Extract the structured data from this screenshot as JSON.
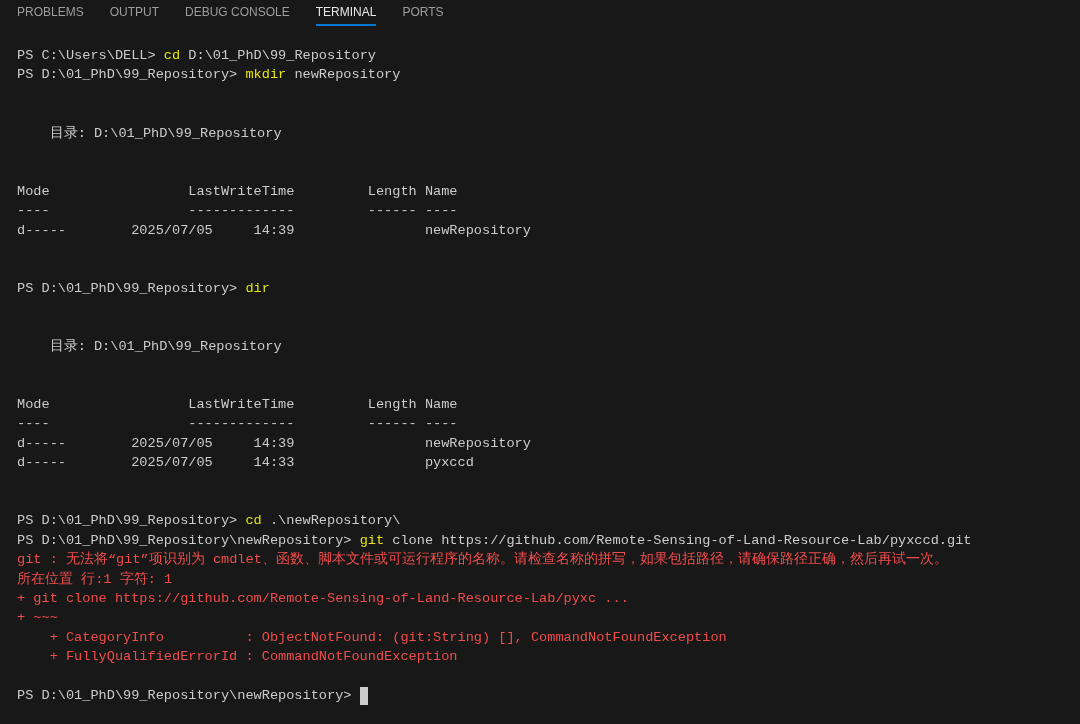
{
  "tabs": [
    {
      "label": "PROBLEMS",
      "selected": false
    },
    {
      "label": "OUTPUT",
      "selected": false
    },
    {
      "label": "DEBUG CONSOLE",
      "selected": false
    },
    {
      "label": "TERMINAL",
      "selected": true
    },
    {
      "label": "PORTS",
      "selected": false
    }
  ],
  "terminal": {
    "lines": [
      {
        "kind": "text",
        "segments": [
          {
            "kind": "prompt",
            "text": "PS C:\\Users\\DELL> "
          },
          {
            "kind": "command",
            "text": "cd"
          },
          {
            "kind": "plain",
            "text": " D:\\01_PhD\\99_Repository"
          }
        ]
      },
      {
        "kind": "text",
        "segments": [
          {
            "kind": "prompt",
            "text": "PS D:\\01_PhD\\99_Repository> "
          },
          {
            "kind": "command",
            "text": "mkdir"
          },
          {
            "kind": "plain",
            "text": " newRepository"
          }
        ]
      },
      {
        "kind": "blank"
      },
      {
        "kind": "blank"
      },
      {
        "kind": "text",
        "segments": [
          {
            "kind": "plain",
            "text": "    目录: D:\\01_PhD\\99_Repository"
          }
        ]
      },
      {
        "kind": "blank"
      },
      {
        "kind": "blank"
      },
      {
        "kind": "text",
        "segments": [
          {
            "kind": "plain",
            "text": "Mode                 LastWriteTime         Length Name"
          }
        ]
      },
      {
        "kind": "text",
        "segments": [
          {
            "kind": "plain",
            "text": "----                 -------------         ------ ----"
          }
        ]
      },
      {
        "kind": "text",
        "segments": [
          {
            "kind": "plain",
            "text": "d-----        2025/07/05     14:39                newRepository"
          }
        ]
      },
      {
        "kind": "blank"
      },
      {
        "kind": "blank"
      },
      {
        "kind": "text",
        "segments": [
          {
            "kind": "prompt",
            "text": "PS D:\\01_PhD\\99_Repository> "
          },
          {
            "kind": "command",
            "text": "dir"
          }
        ]
      },
      {
        "kind": "blank"
      },
      {
        "kind": "blank"
      },
      {
        "kind": "text",
        "segments": [
          {
            "kind": "plain",
            "text": "    目录: D:\\01_PhD\\99_Repository"
          }
        ]
      },
      {
        "kind": "blank"
      },
      {
        "kind": "blank"
      },
      {
        "kind": "text",
        "segments": [
          {
            "kind": "plain",
            "text": "Mode                 LastWriteTime         Length Name"
          }
        ]
      },
      {
        "kind": "text",
        "segments": [
          {
            "kind": "plain",
            "text": "----                 -------------         ------ ----"
          }
        ]
      },
      {
        "kind": "text",
        "segments": [
          {
            "kind": "plain",
            "text": "d-----        2025/07/05     14:39                newRepository"
          }
        ]
      },
      {
        "kind": "text",
        "segments": [
          {
            "kind": "plain",
            "text": "d-----        2025/07/05     14:33                pyxccd"
          }
        ]
      },
      {
        "kind": "blank"
      },
      {
        "kind": "blank"
      },
      {
        "kind": "text",
        "segments": [
          {
            "kind": "prompt",
            "text": "PS D:\\01_PhD\\99_Repository> "
          },
          {
            "kind": "command",
            "text": "cd"
          },
          {
            "kind": "plain",
            "text": " .\\newRepository\\"
          }
        ]
      },
      {
        "kind": "text",
        "segments": [
          {
            "kind": "prompt",
            "text": "PS D:\\01_PhD\\99_Repository\\newRepository> "
          },
          {
            "kind": "command",
            "text": "git"
          },
          {
            "kind": "plain",
            "text": " clone https://github.com/Remote-Sensing-of-Land-Resource-Lab/pyxccd.git"
          }
        ]
      },
      {
        "kind": "text",
        "segments": [
          {
            "kind": "error",
            "text": "git : 无法将“git”项识别为 cmdlet、函数、脚本文件或可运行程序的名称。请检查名称的拼写，如果包括路径，请确保路径正确，然后再试一次。"
          }
        ]
      },
      {
        "kind": "text",
        "segments": [
          {
            "kind": "error",
            "text": "所在位置 行:1 字符: 1"
          }
        ]
      },
      {
        "kind": "text",
        "segments": [
          {
            "kind": "error",
            "text": "+ git clone https://github.com/Remote-Sensing-of-Land-Resource-Lab/pyxc ..."
          }
        ]
      },
      {
        "kind": "text",
        "segments": [
          {
            "kind": "error",
            "text": "+ ~~~"
          }
        ]
      },
      {
        "kind": "text",
        "segments": [
          {
            "kind": "error",
            "text": "    + CategoryInfo          : ObjectNotFound: (git:String) [], CommandNotFoundException"
          }
        ]
      },
      {
        "kind": "text",
        "segments": [
          {
            "kind": "error",
            "text": "    + FullyQualifiedErrorId : CommandNotFoundException"
          }
        ]
      },
      {
        "kind": "blank"
      },
      {
        "kind": "cursor",
        "segments": [
          {
            "kind": "prompt",
            "text": "PS D:\\01_PhD\\99_Repository\\newRepository> "
          }
        ]
      }
    ]
  }
}
